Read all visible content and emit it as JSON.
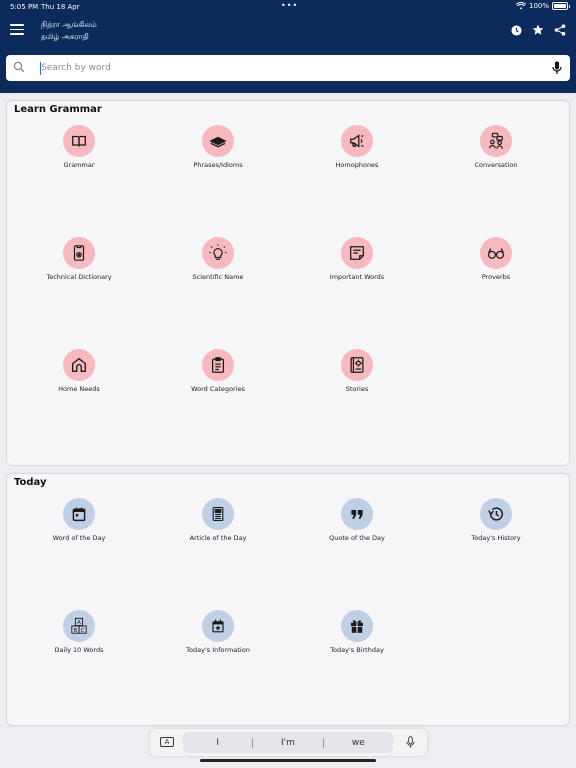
{
  "status": {
    "time": "5:05 PM",
    "date": "Thu 18 Apr",
    "battery": "100%"
  },
  "app": {
    "title_line1": "நித்ரா ஆங்கிலம்",
    "title_line2": "தமிழ் அகராதி"
  },
  "search": {
    "placeholder": "Search by word",
    "value": ""
  },
  "sections": {
    "grammar": {
      "title": "Learn Grammar",
      "items": [
        {
          "label": "Grammar",
          "icon": "book-icon"
        },
        {
          "label": "Phrases/Idioms",
          "icon": "book-stack-icon"
        },
        {
          "label": "Homophones",
          "icon": "megaphone-icon"
        },
        {
          "label": "Conversation",
          "icon": "chat-people-icon"
        },
        {
          "label": "Technical Dictionary",
          "icon": "gear-document-icon"
        },
        {
          "label": "Scientific Name",
          "icon": "lightbulb-icon"
        },
        {
          "label": "Important Words",
          "icon": "note-icon"
        },
        {
          "label": "Proverbs",
          "icon": "glasses-icon"
        },
        {
          "label": "Home Needs",
          "icon": "house-icon"
        },
        {
          "label": "Word Categories",
          "icon": "clipboard-icon"
        },
        {
          "label": "Stories",
          "icon": "storybook-icon"
        }
      ]
    },
    "today": {
      "title": "Today",
      "items": [
        {
          "label": "Word of the Day",
          "icon": "calendar-icon"
        },
        {
          "label": "Article of the Day",
          "icon": "article-icon"
        },
        {
          "label": "Quote of the Day",
          "icon": "quote-icon"
        },
        {
          "label": "Today's History",
          "icon": "history-icon"
        },
        {
          "label": "Daily 10 Words",
          "icon": "abc-blocks-icon"
        },
        {
          "label": "Today's Information",
          "icon": "calendar-star-icon"
        },
        {
          "label": "Today's Birthday",
          "icon": "gift-icon"
        }
      ]
    }
  },
  "keyboard": {
    "suggestions": [
      "I",
      "I'm",
      "we"
    ],
    "a_key": "A"
  },
  "colors": {
    "header": "#0c2a5c",
    "pink_circle": "#f6b9be",
    "blue_circle": "#c0d0e4",
    "card": "#f6f6f9"
  }
}
